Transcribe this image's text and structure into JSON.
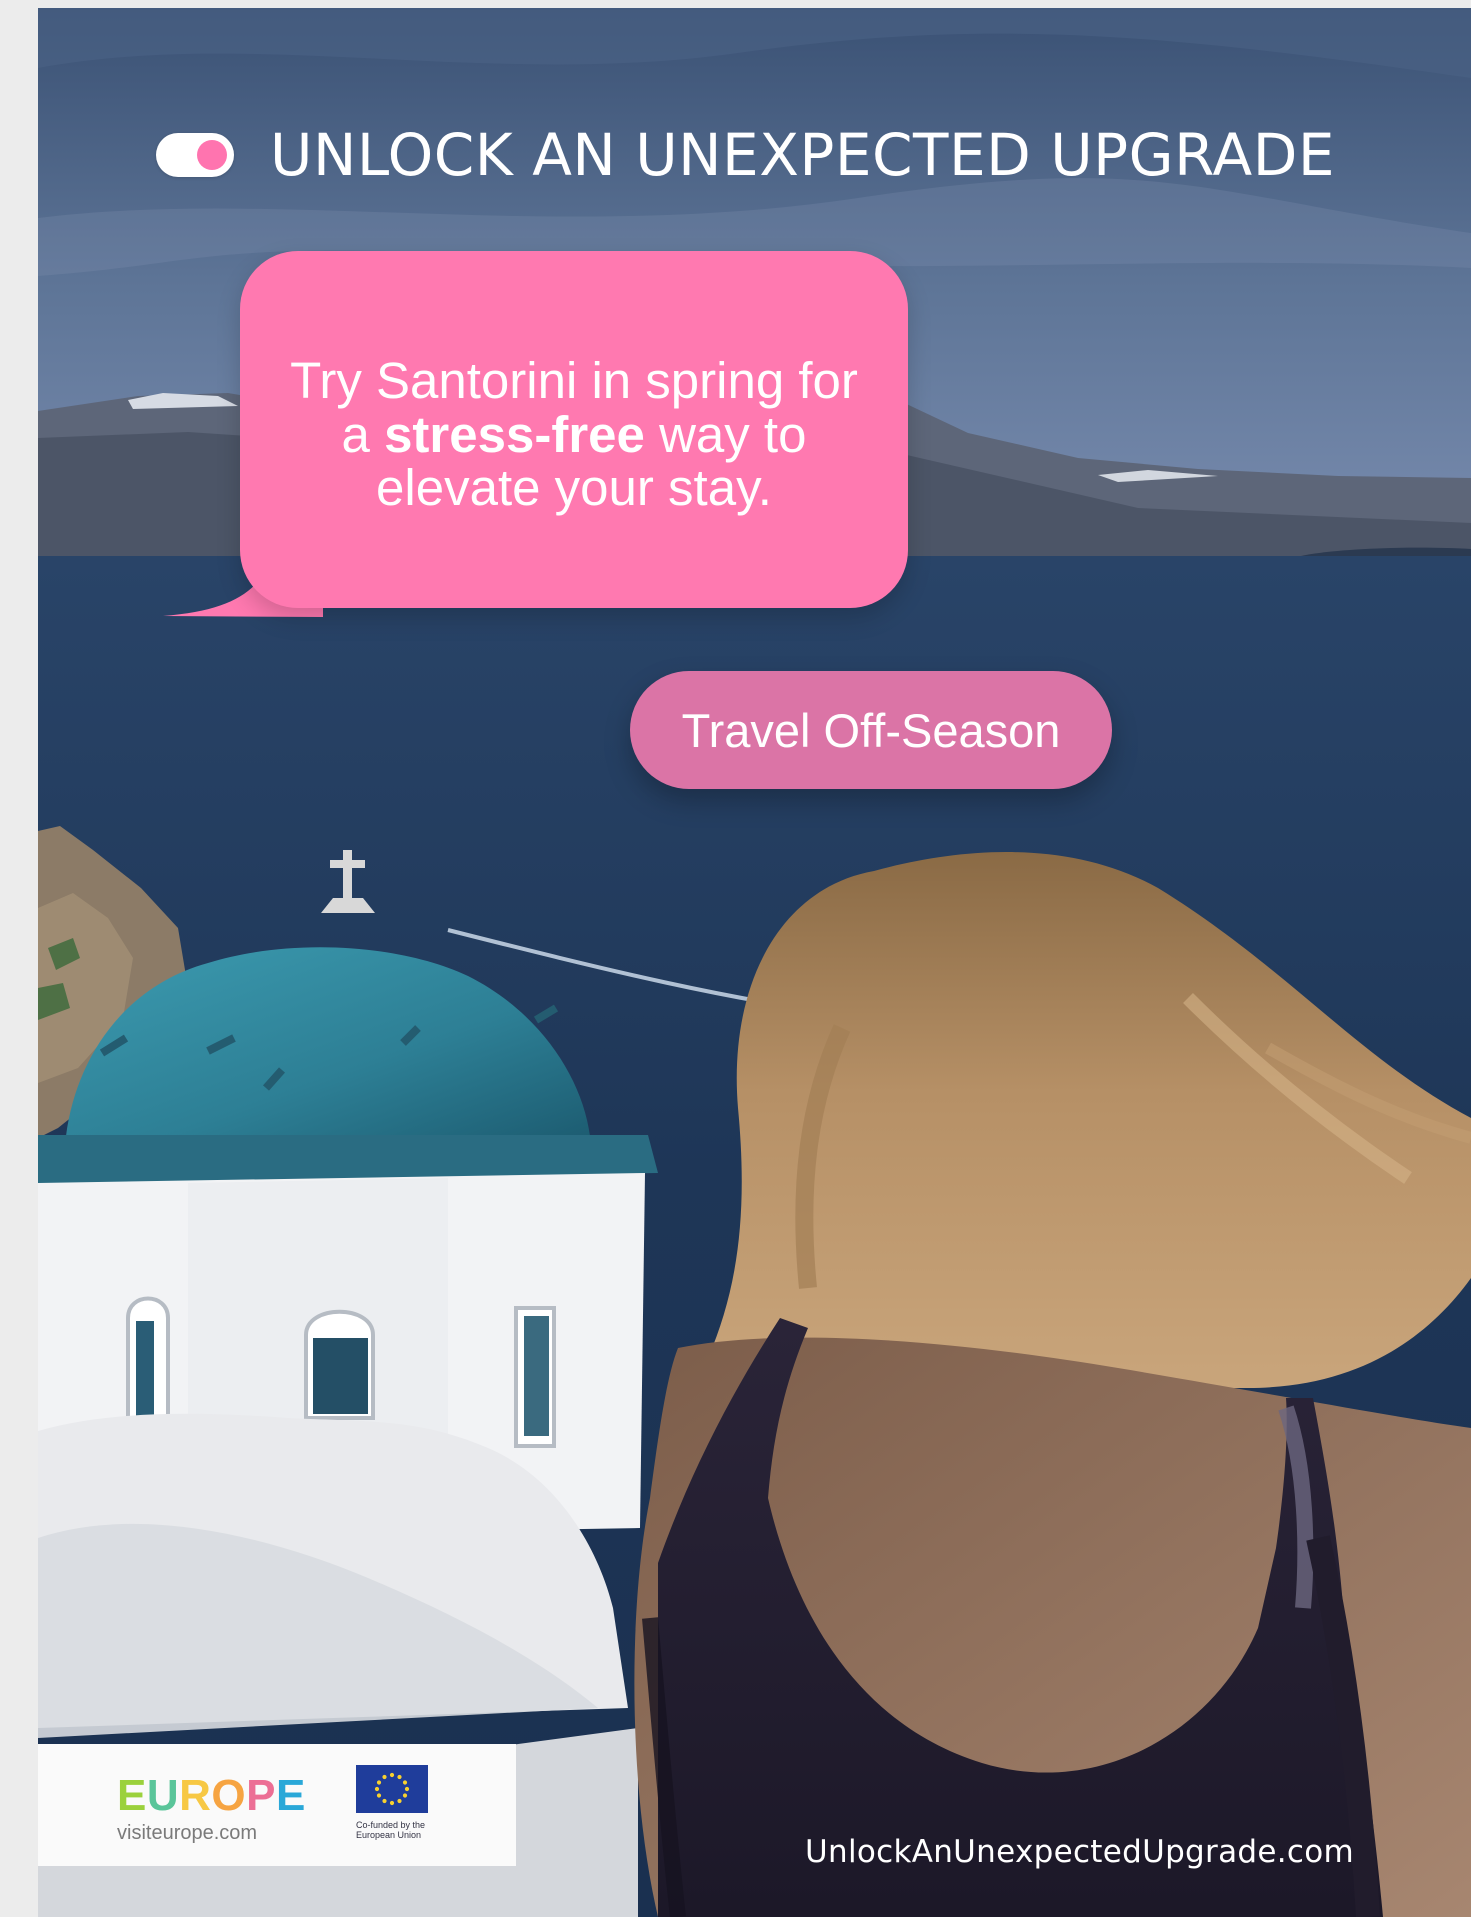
{
  "header": {
    "title": "UNLOCK AN UNEXPECTED UPGRADE"
  },
  "message": {
    "line1": "Try Santorini in spring for",
    "prefix": "a",
    "emphasis": "stress-free",
    "suffix": "way to",
    "line3": "elevate your stay."
  },
  "cta": {
    "label": "Travel Off-Season"
  },
  "logos": {
    "brand_letters": [
      "E",
      "U",
      "R",
      "O",
      "P",
      "E"
    ],
    "brand_url": "visiteurope.com",
    "eu_caption_line1": "Co-funded by the",
    "eu_caption_line2": "European Union"
  },
  "footer": {
    "url": "UnlockAnUnexpectedUpgrade.com"
  },
  "colors": {
    "accent_pink": "#ff79b0",
    "button_pink": "#db74a6",
    "sea_blue": "#1e3758",
    "dome_teal": "#2f7f94"
  },
  "icons": {
    "toggle": "toggle-on-icon",
    "eu_flag": "eu-flag-icon",
    "speech_bubble": "speech-bubble-icon"
  }
}
